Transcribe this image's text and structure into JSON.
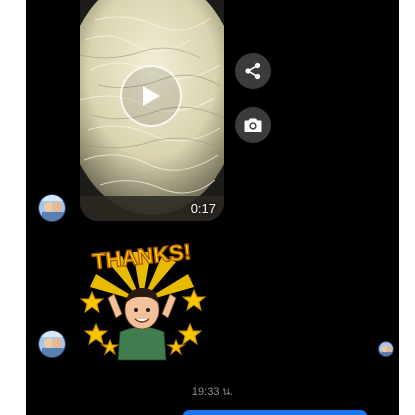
{
  "conversation": {
    "video_message": {
      "duration": "0:17",
      "play_icon": "play-icon"
    },
    "actions": {
      "share_icon": "share-icon",
      "camera_icon": "camera-icon"
    },
    "sticker": {
      "text": "THANKS!"
    },
    "timestamp": "19:33 น."
  },
  "colors": {
    "background": "#000000",
    "action_button": "#3a3b3c",
    "timestamp_text": "#8a8d91",
    "accent": "#1877f2",
    "sticker_yellow": "#f5c400"
  }
}
